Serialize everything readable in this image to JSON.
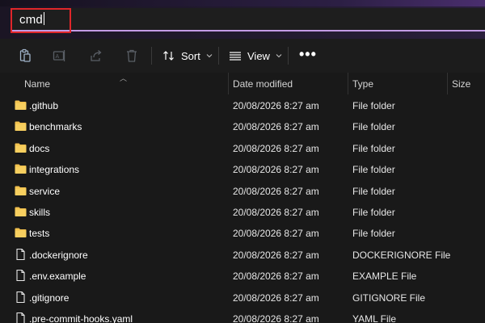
{
  "address_bar": {
    "value": "cmd"
  },
  "command_bar": {
    "icons": [
      "paste-icon",
      "rename-icon",
      "share-icon",
      "delete-icon"
    ],
    "sort_label": "Sort",
    "view_label": "View",
    "more_label": "•••"
  },
  "columns": {
    "name": "Name",
    "date": "Date modified",
    "type": "Type",
    "size": "Size"
  },
  "files": [
    {
      "name": ".github",
      "date": "20/08/2026 8:27 am",
      "type": "File folder",
      "icon": "folder-icon"
    },
    {
      "name": "benchmarks",
      "date": "20/08/2026 8:27 am",
      "type": "File folder",
      "icon": "folder-icon"
    },
    {
      "name": "docs",
      "date": "20/08/2026 8:27 am",
      "type": "File folder",
      "icon": "folder-icon"
    },
    {
      "name": "integrations",
      "date": "20/08/2026 8:27 am",
      "type": "File folder",
      "icon": "folder-icon"
    },
    {
      "name": "service",
      "date": "20/08/2026 8:27 am",
      "type": "File folder",
      "icon": "folder-icon"
    },
    {
      "name": "skills",
      "date": "20/08/2026 8:27 am",
      "type": "File folder",
      "icon": "folder-icon"
    },
    {
      "name": "tests",
      "date": "20/08/2026 8:27 am",
      "type": "File folder",
      "icon": "folder-icon"
    },
    {
      "name": ".dockerignore",
      "date": "20/08/2026 8:27 am",
      "type": "DOCKERIGNORE File",
      "icon": "file-icon"
    },
    {
      "name": ".env.example",
      "date": "20/08/2026 8:27 am",
      "type": "EXAMPLE File",
      "icon": "file-icon"
    },
    {
      "name": ".gitignore",
      "date": "20/08/2026 8:27 am",
      "type": "GITIGNORE File",
      "icon": "file-icon"
    },
    {
      "name": ".pre-commit-hooks.yaml",
      "date": "20/08/2026 8:27 am",
      "type": "YAML File",
      "icon": "file-icon"
    }
  ],
  "colors": {
    "highlight": "#e0262a",
    "folder": "#f2c14e",
    "accent_underline": "#c39be6"
  }
}
